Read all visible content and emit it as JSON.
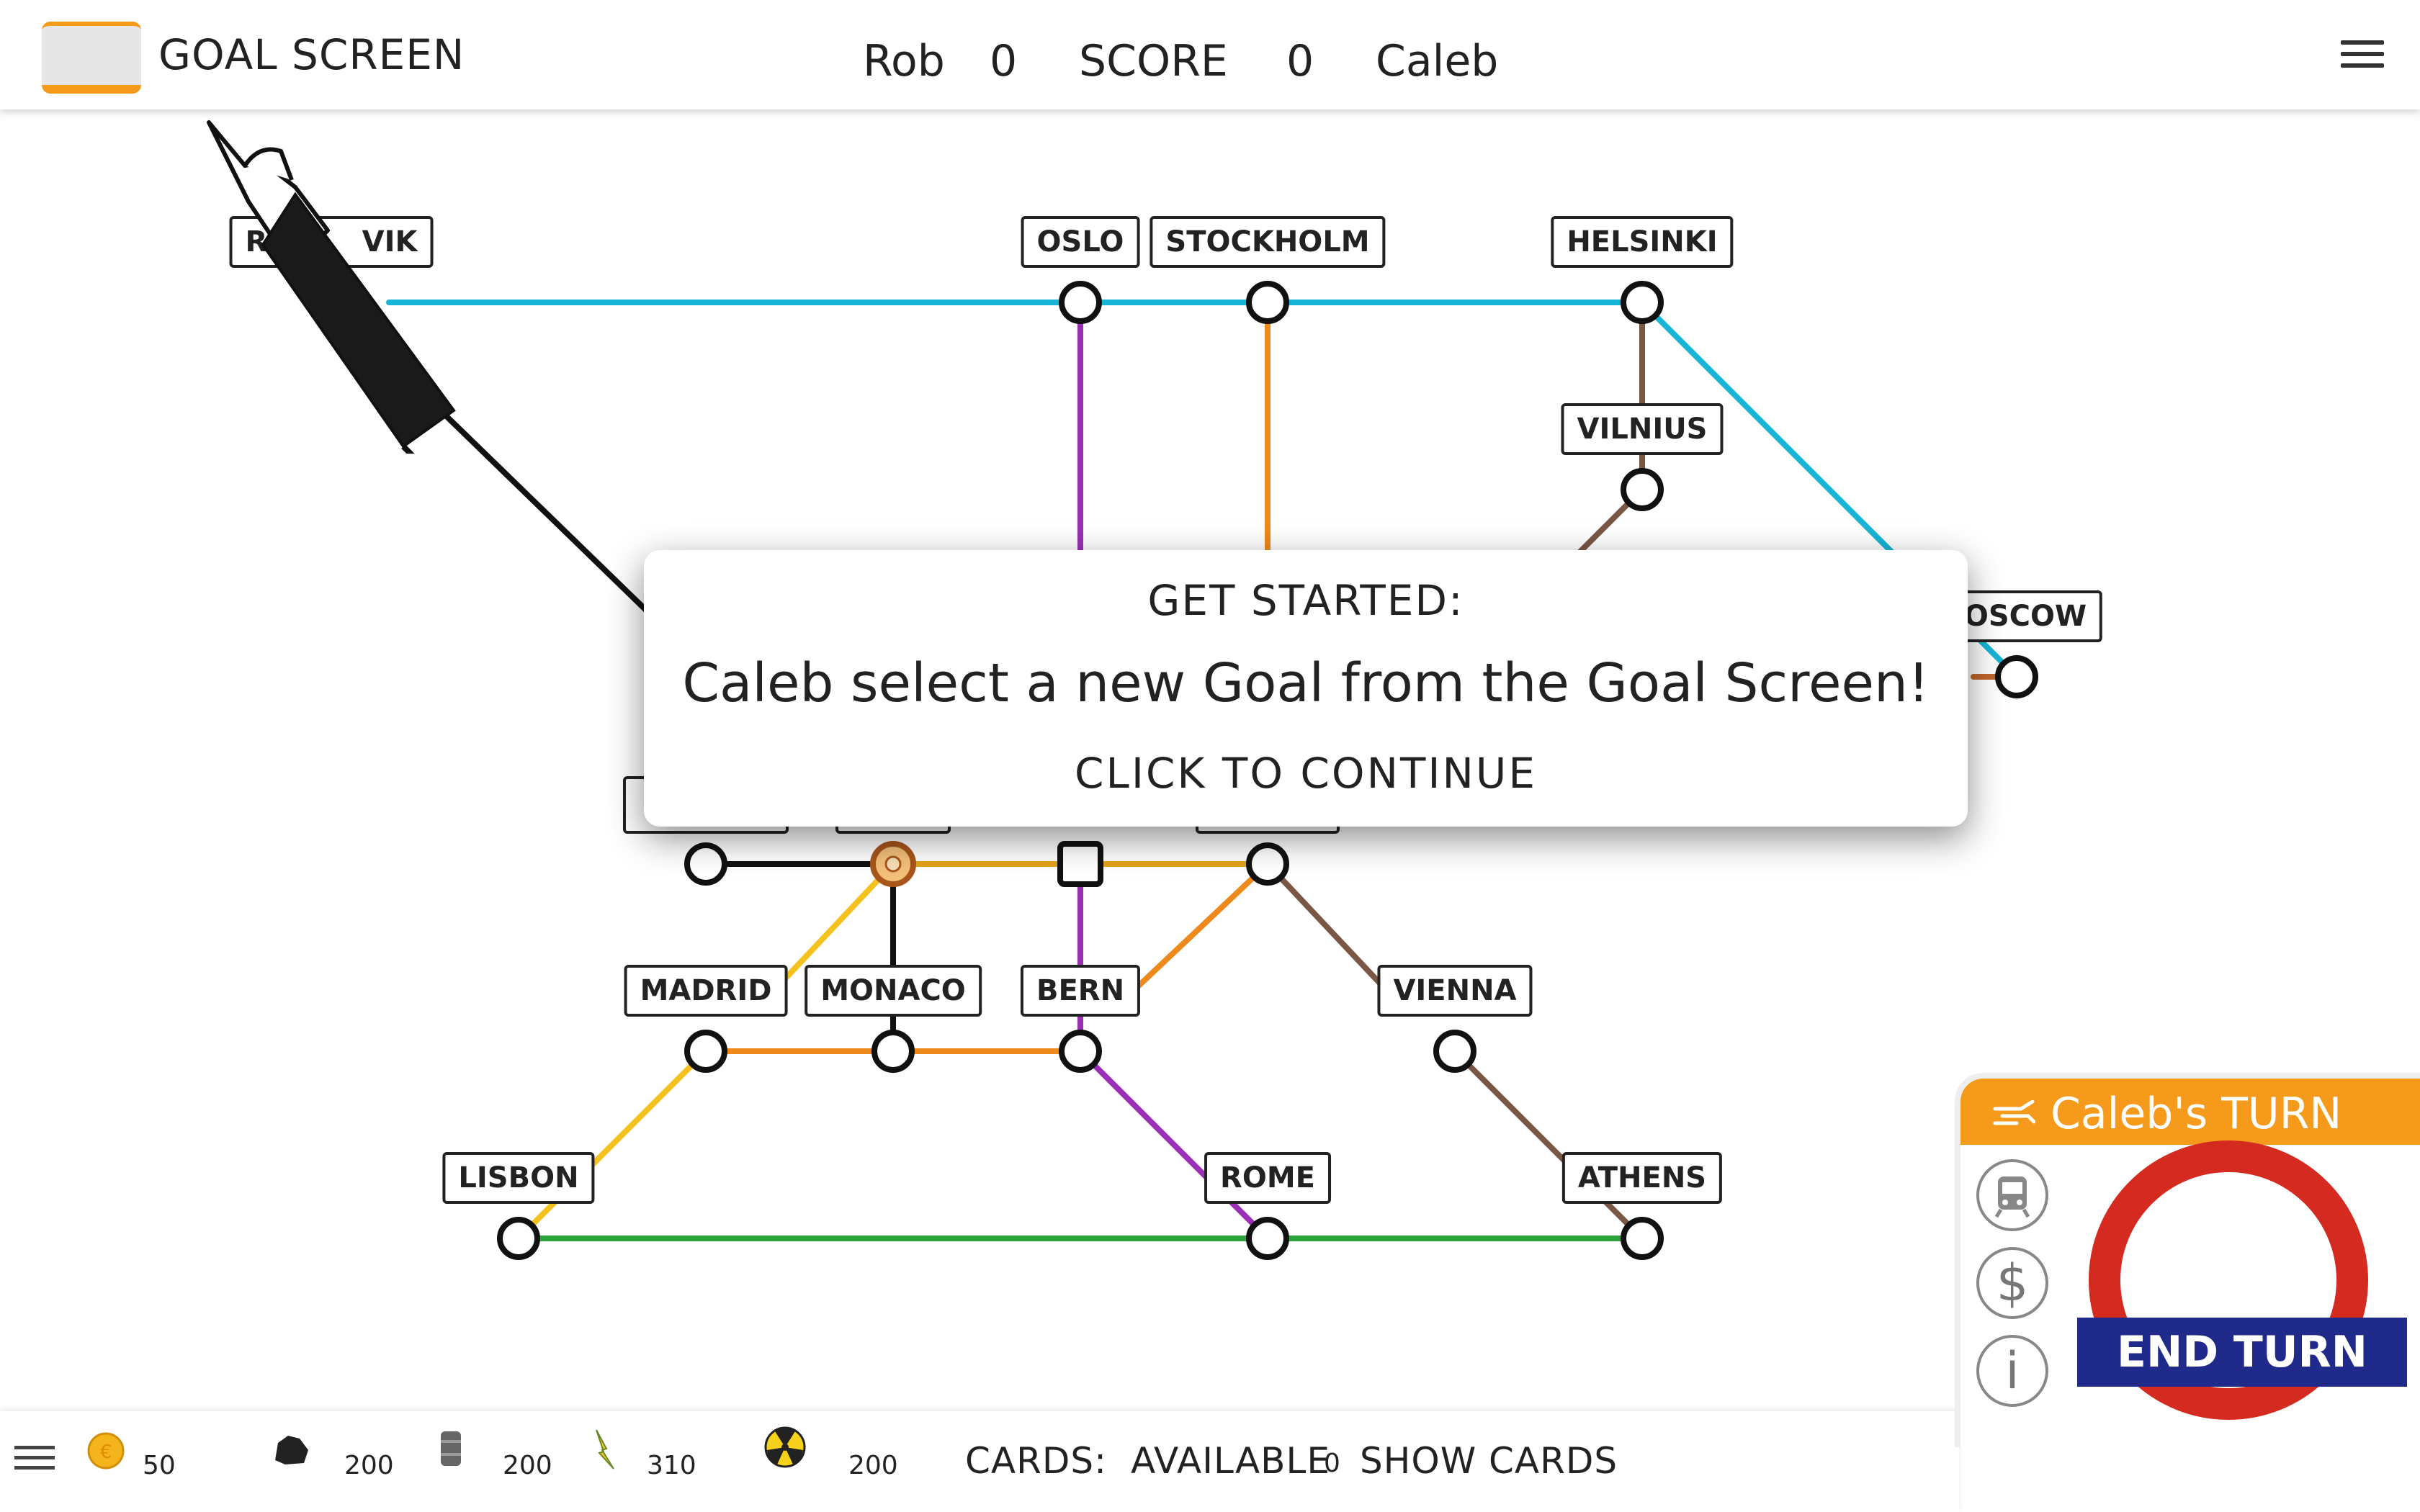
{
  "header": {
    "goal_screen_label": "GOAL SCREEN",
    "player1_name": "Rob",
    "player1_score": "0",
    "score_label": "SCORE",
    "player2_score": "0",
    "player2_name": "Caleb"
  },
  "map": {
    "stations": [
      {
        "name": "RE",
        "label_tail": "VIK"
      },
      {
        "name": "OSLO"
      },
      {
        "name": "STOCKHOLM"
      },
      {
        "name": "HELSINKI"
      },
      {
        "name": "VILNIUS"
      },
      {
        "name": "OSCOW"
      },
      {
        "name": "MADRID"
      },
      {
        "name": "MONACO"
      },
      {
        "name": "BERN"
      },
      {
        "name": "VIENNA"
      },
      {
        "name": "LISBON"
      },
      {
        "name": "ROME"
      },
      {
        "name": "ATHENS"
      }
    ],
    "line_colors": {
      "cyan": "#18b4d6",
      "purple": "#9b30b7",
      "orange": "#ee8a1b",
      "brown": "#7a5745",
      "yellow": "#f4c11e",
      "black": "#111111",
      "green": "#2ea33a"
    }
  },
  "dialog": {
    "heading": "GET STARTED:",
    "message": "Caleb select a new Goal from the Goal Screen!",
    "cta": "CLICK TO  CONTINUE"
  },
  "resources": {
    "coins": "50",
    "coal": "200",
    "oil": "200",
    "electric": "310",
    "nuclear": "200",
    "cards_label": "CARDS:",
    "available_label": "AVAILABLE",
    "available_count": "0",
    "show_cards_label": "SHOW CARDS"
  },
  "turn": {
    "text": "Caleb's TURN",
    "end_turn_label": "END TURN",
    "icons": [
      "train-icon",
      "dollar-icon",
      "info-icon"
    ],
    "accent": "#f59a1b",
    "roundel_red": "#d42a1f",
    "roundel_blue": "#1f2a8a"
  }
}
